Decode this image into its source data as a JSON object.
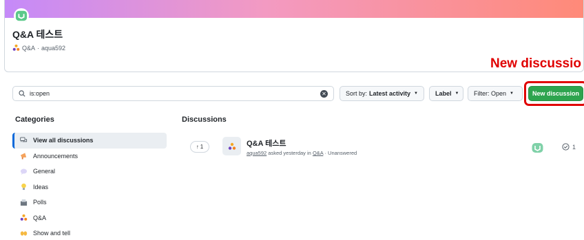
{
  "header": {
    "title": "Q&A 테스트",
    "category": "Q&A",
    "separator": "·",
    "owner": "aqua592"
  },
  "callout": "New discussio",
  "search": {
    "value": "is:open",
    "clear_icon": "x-circle-icon"
  },
  "toolbar": {
    "sort_prefix": "Sort by:",
    "sort_value": "Latest activity",
    "label": "Label",
    "filter": "Filter: Open",
    "new_discussion": "New discussion"
  },
  "sidebar": {
    "heading": "Categories",
    "items": [
      {
        "label": "View all discussions",
        "icon": "discussions-icon",
        "active": true
      },
      {
        "label": "Announcements",
        "icon": "megaphone-icon"
      },
      {
        "label": "General",
        "icon": "speech-bubble-icon"
      },
      {
        "label": "Ideas",
        "icon": "lightbulb-icon"
      },
      {
        "label": "Polls",
        "icon": "ballot-box-icon"
      },
      {
        "label": "Q&A",
        "icon": "qa-icon"
      },
      {
        "label": "Show and tell",
        "icon": "raised-hands-icon"
      }
    ]
  },
  "discussions": {
    "heading": "Discussions",
    "items": [
      {
        "votes": "1",
        "title": "Q&A 테스트",
        "author": "aqua592",
        "meta": "asked yesterday in",
        "category": "Q&A",
        "status": "· Unanswered",
        "comments": "1"
      }
    ]
  },
  "colors": {
    "accent": "#0969da",
    "primary_button": "#2da44e",
    "callout": "#e00000"
  }
}
